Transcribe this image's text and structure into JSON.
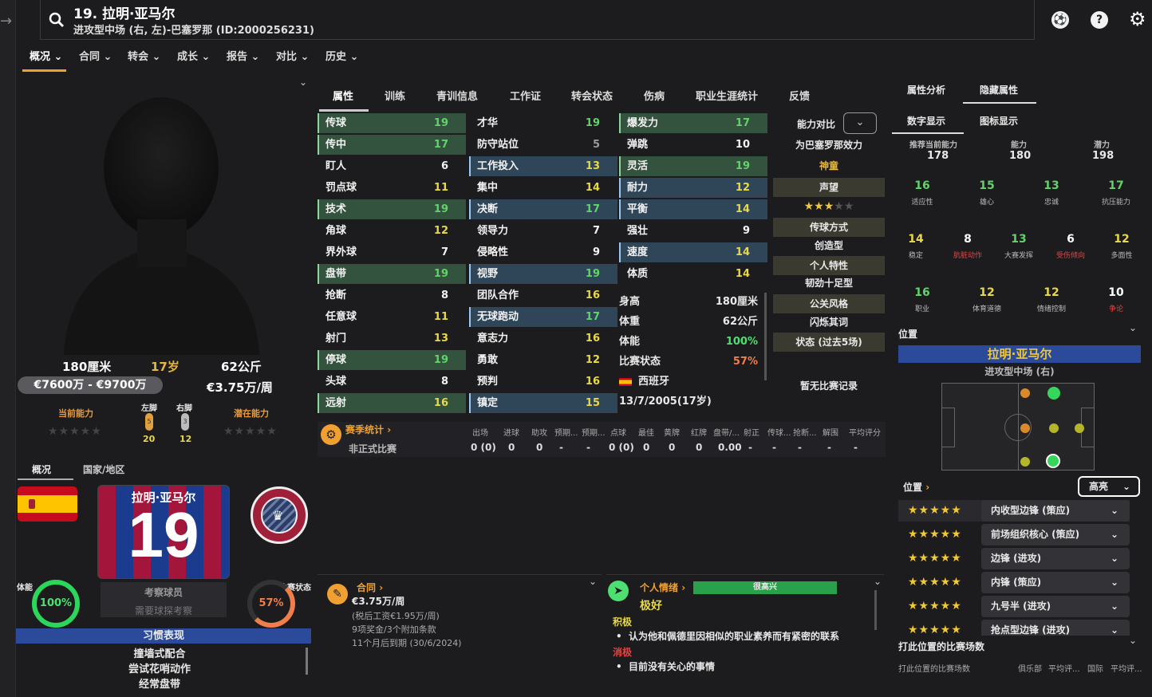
{
  "header": {
    "title": "19. 拉明·亚马尔",
    "subtitle": "进攻型中场 (右, 左)-巴塞罗那 (ID:2000256231)"
  },
  "nav": [
    "概况",
    "合同",
    "转会",
    "成长",
    "报告",
    "对比",
    "历史"
  ],
  "profile": {
    "height": "180厘米",
    "age": "17岁",
    "weight": "62公斤",
    "value": "€7600万 - €9700万",
    "wage": "€3.75万/周",
    "current_ability_label": "当前能力",
    "potential_label": "潜在能力",
    "left_foot_label": "左脚",
    "right_foot_label": "右脚",
    "left_foot_value": "20",
    "right_foot_value": "12",
    "left_foot_num": "5",
    "right_foot_num": "3",
    "tab_overview": "概况",
    "tab_country": "国家/地区",
    "shirt_name": "拉明·亚马尔",
    "shirt_number": "19",
    "scout_title": "考察球员",
    "scout_sub": "需要球探考察",
    "fitness_label": "体能",
    "fitness_value": "100%",
    "match_label": "比赛状态",
    "match_value": "57%",
    "habits_title": "习惯表现",
    "habits": [
      "撞墙式配合",
      "尝试花哨动作",
      "经常盘带"
    ]
  },
  "mid_tabs": [
    "属性",
    "训练",
    "青训信息",
    "工作证",
    "转会状态",
    "伤病",
    "职业生涯统计",
    "反馈"
  ],
  "attributes": {
    "col1": [
      {
        "name": "传球",
        "value": "19"
      },
      {
        "name": "传中",
        "value": "17"
      },
      {
        "name": "盯人",
        "value": "6"
      },
      {
        "name": "罚点球",
        "value": "11"
      },
      {
        "name": "技术",
        "value": "19"
      },
      {
        "name": "角球",
        "value": "12"
      },
      {
        "name": "界外球",
        "value": "7"
      },
      {
        "name": "盘带",
        "value": "19"
      },
      {
        "name": "抢断",
        "value": "8"
      },
      {
        "name": "任意球",
        "value": "11"
      },
      {
        "name": "射门",
        "value": "13"
      },
      {
        "name": "停球",
        "value": "19"
      },
      {
        "name": "头球",
        "value": "8"
      },
      {
        "name": "远射",
        "value": "16"
      }
    ],
    "col2": [
      {
        "name": "才华",
        "value": "19"
      },
      {
        "name": "防守站位",
        "value": "5"
      },
      {
        "name": "工作投入",
        "value": "13"
      },
      {
        "name": "集中",
        "value": "14"
      },
      {
        "name": "决断",
        "value": "17"
      },
      {
        "name": "领导力",
        "value": "7"
      },
      {
        "name": "侵略性",
        "value": "9"
      },
      {
        "name": "视野",
        "value": "19"
      },
      {
        "name": "团队合作",
        "value": "16"
      },
      {
        "name": "无球跑动",
        "value": "17"
      },
      {
        "name": "意志力",
        "value": "16"
      },
      {
        "name": "勇敢",
        "value": "12"
      },
      {
        "name": "预判",
        "value": "16"
      },
      {
        "name": "镇定",
        "value": "15"
      }
    ],
    "col3": [
      {
        "name": "爆发力",
        "value": "17"
      },
      {
        "name": "弹跳",
        "value": "10"
      },
      {
        "name": "灵活",
        "value": "19"
      },
      {
        "name": "耐力",
        "value": "12"
      },
      {
        "name": "平衡",
        "value": "14"
      },
      {
        "name": "强壮",
        "value": "9"
      },
      {
        "name": "速度",
        "value": "14"
      },
      {
        "name": "体质",
        "value": "14"
      }
    ]
  },
  "info": {
    "height_label": "身高",
    "height_value": "180厘米",
    "weight_label": "体重",
    "weight_value": "62公斤",
    "fitness_label": "体能",
    "fitness_value": "100%",
    "match_label": "比赛状态",
    "match_value": "57%",
    "nation": "西班牙",
    "dob": "13/7/2005(17岁)"
  },
  "compare": {
    "label": "能力对比",
    "effort_title": "为巴塞罗那效力",
    "effort_value": "神童",
    "reputation": "声望",
    "pass_style": "传球方式",
    "pass_style_value": "创造型",
    "trait": "个人特性",
    "trait_value": "韧劲十足型",
    "pr_style": "公关风格",
    "pr_style_value": "闪烁其词",
    "form_label": "状态 (过去5场)",
    "no_record": "暂无比赛记录"
  },
  "season": {
    "title": "赛季统计",
    "row_label": "非正式比赛",
    "headers": [
      "出场",
      "进球",
      "助攻",
      "预期...",
      "预期...",
      "点球",
      "最佳",
      "黄牌",
      "红牌",
      "盘带/...",
      "射正",
      "传球...",
      "抢断...",
      "解围",
      "平均评分"
    ],
    "values": [
      "0 (0)",
      "0",
      "0",
      "-",
      "-",
      "0 (0)",
      "0",
      "0",
      "0",
      "0.00",
      "-",
      "-",
      "-",
      "-",
      "-"
    ]
  },
  "contract": {
    "title": "合同",
    "wage": "€3.75万/周",
    "tax": "(税后工资€1.95万/周)",
    "bonus": "9项奖金/3个附加条款",
    "expiry": "11个月后到期 (30/6/2024)"
  },
  "mood": {
    "title": "个人情绪",
    "bar_label": "很高兴",
    "value": "极好",
    "positive_label": "积极",
    "positive_item": "认为他和佩德里因相似的职业素养而有紧密的联系",
    "negative_label": "消极",
    "negative_item": "目前没有关心的事情"
  },
  "right": {
    "tab_attr_analysis": "属性分析",
    "tab_hidden": "隐藏属性",
    "tab_numeric": "数字显示",
    "tab_icon": "图标显示",
    "ca_label": "推荐当前能力",
    "ca_value": "178",
    "ability_label": "能力",
    "ability_value": "180",
    "potential_label": "潜力",
    "potential_value": "198",
    "hidden": [
      {
        "value": "16",
        "label": "适应性",
        "color": "#62d36a"
      },
      {
        "value": "15",
        "label": "雄心",
        "color": "#62d36a"
      },
      {
        "value": "13",
        "label": "忠诚",
        "color": "#62d36a"
      },
      {
        "value": "17",
        "label": "抗压能力",
        "color": "#62d36a"
      },
      {
        "value": "14",
        "label": "稳定",
        "color": "#e8d84a"
      },
      {
        "value": "8",
        "label": "肮脏动作",
        "color": "#ffffff"
      },
      {
        "value": "13",
        "label": "大赛发挥",
        "color": "#62d36a"
      },
      {
        "value": "6",
        "label": "受伤倾向",
        "color": "#ffffff"
      },
      {
        "value": "12",
        "label": "多面性",
        "color": "#e8d84a"
      },
      {
        "value": "16",
        "label": "职业",
        "color": "#62d36a"
      },
      {
        "value": "12",
        "label": "体育道德",
        "color": "#e8d84a"
      },
      {
        "value": "12",
        "label": "情绪控制",
        "color": "#e8d84a"
      },
      {
        "value": "10",
        "label": "争论",
        "color": "#ffffff"
      }
    ],
    "position_title": "位置",
    "player_name": "拉明·亚马尔",
    "player_pos": "进攻型中场 (右)",
    "positions_label": "位置",
    "highlight_label": "高亮",
    "roles": [
      {
        "name": "内收型边锋 (策应)",
        "stars": "★★★★★"
      },
      {
        "name": "前场组织核心 (策应)",
        "stars": "★★★★★"
      },
      {
        "name": "边锋 (进攻)",
        "stars": "★★★★★"
      },
      {
        "name": "内锋 (策应)",
        "stars": "★★★★★"
      },
      {
        "name": "九号半 (进攻)",
        "stars": "★★★★★"
      },
      {
        "name": "抢点型边锋 (进攻)",
        "stars": "★★★★★"
      }
    ],
    "played_title": "打此位置的比赛场数",
    "played_sub": "打此位置的比赛场数",
    "played_club": "俱乐部",
    "played_avg1": "平均评...",
    "played_nat": "国际",
    "played_avg2": "平均评..."
  },
  "colors": {
    "accent": "#f0a030",
    "green": "#62d36a",
    "blue_bar": "#2b4a9a"
  }
}
